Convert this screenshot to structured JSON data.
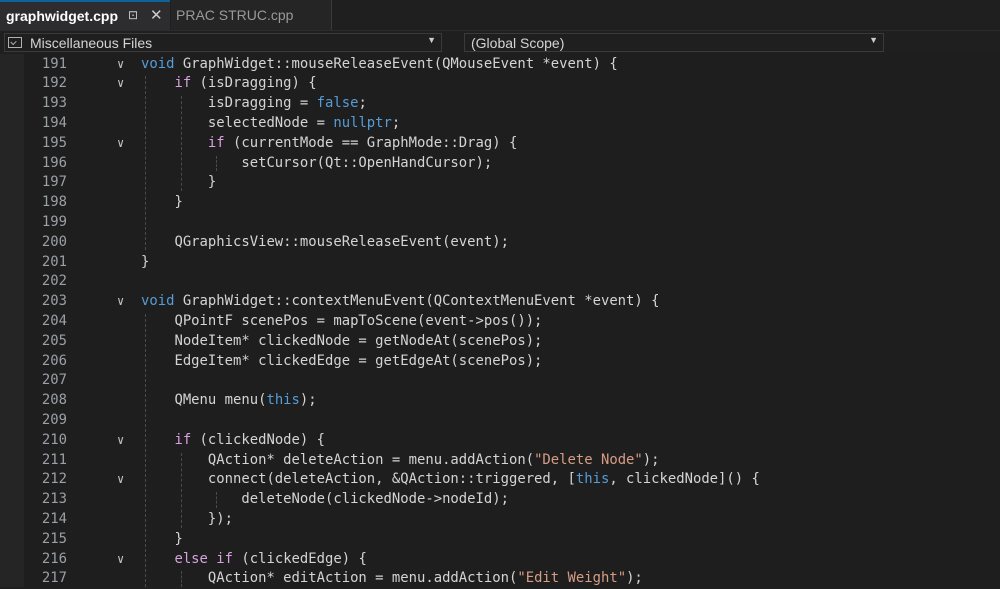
{
  "tabs": [
    {
      "label": "graphwidget.cpp",
      "active": true,
      "pin_icon": "pin-icon",
      "close_icon": "close-icon"
    },
    {
      "label": "PRAC STRUC.cpp",
      "active": false
    }
  ],
  "nav": {
    "project_combo": "Miscellaneous Files",
    "scope_combo": "(Global Scope)"
  },
  "colors": {
    "keyword": "#569cd6",
    "control": "#d8a0df",
    "string": "#d69d85",
    "text": "#d4d4d4",
    "line_number": "#9aa0a6"
  },
  "code": {
    "line_numbers": [
      "191",
      "192",
      "193",
      "194",
      "195",
      "196",
      "197",
      "198",
      "199",
      "200",
      "201",
      "202",
      "203",
      "204",
      "205",
      "206",
      "207",
      "208",
      "209",
      "210",
      "211",
      "212",
      "213",
      "214",
      "215",
      "216",
      "217"
    ],
    "lines": [
      "void GraphWidget::mouseReleaseEvent(QMouseEvent *event) {",
      "    if (isDragging) {",
      "        isDragging = false;",
      "        selectedNode = nullptr;",
      "        if (currentMode == GraphMode::Drag) {",
      "            setCursor(Qt::OpenHandCursor);",
      "        }",
      "    }",
      "",
      "    QGraphicsView::mouseReleaseEvent(event);",
      "}",
      "",
      "void GraphWidget::contextMenuEvent(QContextMenuEvent *event) {",
      "    QPointF scenePos = mapToScene(event->pos());",
      "    NodeItem* clickedNode = getNodeAt(scenePos);",
      "    EdgeItem* clickedEdge = getEdgeAt(scenePos);",
      "",
      "    QMenu menu(this);",
      "",
      "    if (clickedNode) {",
      "        QAction* deleteAction = menu.addAction(\"Delete Node\");",
      "        connect(deleteAction, &QAction::triggered, [this, clickedNode]() {",
      "            deleteNode(clickedNode->nodeId);",
      "        });",
      "    }",
      "    else if (clickedEdge) {",
      "        QAction* editAction = menu.addAction(\"Edit Weight\");"
    ]
  }
}
